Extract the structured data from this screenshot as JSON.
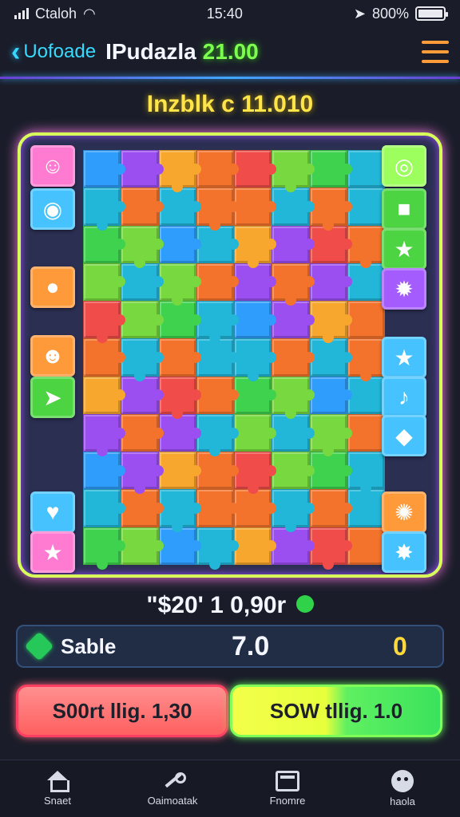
{
  "status_bar": {
    "carrier": "Ctaloh",
    "time": "15:40",
    "battery": "800%"
  },
  "header": {
    "back_label": "Uofoade",
    "title": "IPudazla",
    "score": "21.00"
  },
  "level_text": "Inzblk c 11.010",
  "board": {
    "left_tiles": [
      "cat-face-icon",
      "drop-icon",
      "blob-icon",
      "ghost-face-icon",
      "fish-icon",
      "heart-icon",
      "star-icon"
    ],
    "right_tiles": [
      "eye-icon",
      "monster-icon",
      "star-icon",
      "splat-icon",
      "star-icon",
      "note-icon",
      "shield-icon",
      "splash-icon",
      "starburst-icon"
    ],
    "left_colors": [
      "#ff7bd1",
      "#46c3ff",
      "#ff9a3b",
      "#ff9a3b",
      "#4dd442",
      "#46c3ff",
      "#ff7bd1"
    ],
    "right_colors": [
      "#9cff5e",
      "#4dd442",
      "#4dd442",
      "#a45cff",
      "#46c3ff",
      "#46c3ff",
      "#46c3ff",
      "#ff9a3b",
      "#46c3ff"
    ],
    "palette": [
      "#2f9dfb",
      "#f4732c",
      "#3fd24e",
      "#9c4ff0",
      "#ef4c4a",
      "#22b6d8",
      "#f7a72d",
      "#78d83f"
    ]
  },
  "score_line": "\"$20' 1 0,90r",
  "stable_panel": {
    "label": "Sable",
    "value": "7.0",
    "count": "0"
  },
  "actions": {
    "short_label": "S00rt llig. 1,30",
    "slow_label": "SOW tllig. 1.0"
  },
  "nav": {
    "home": "Snaet",
    "tools": "Oaimoatak",
    "frame": "Fnomre",
    "profile": "haola"
  }
}
